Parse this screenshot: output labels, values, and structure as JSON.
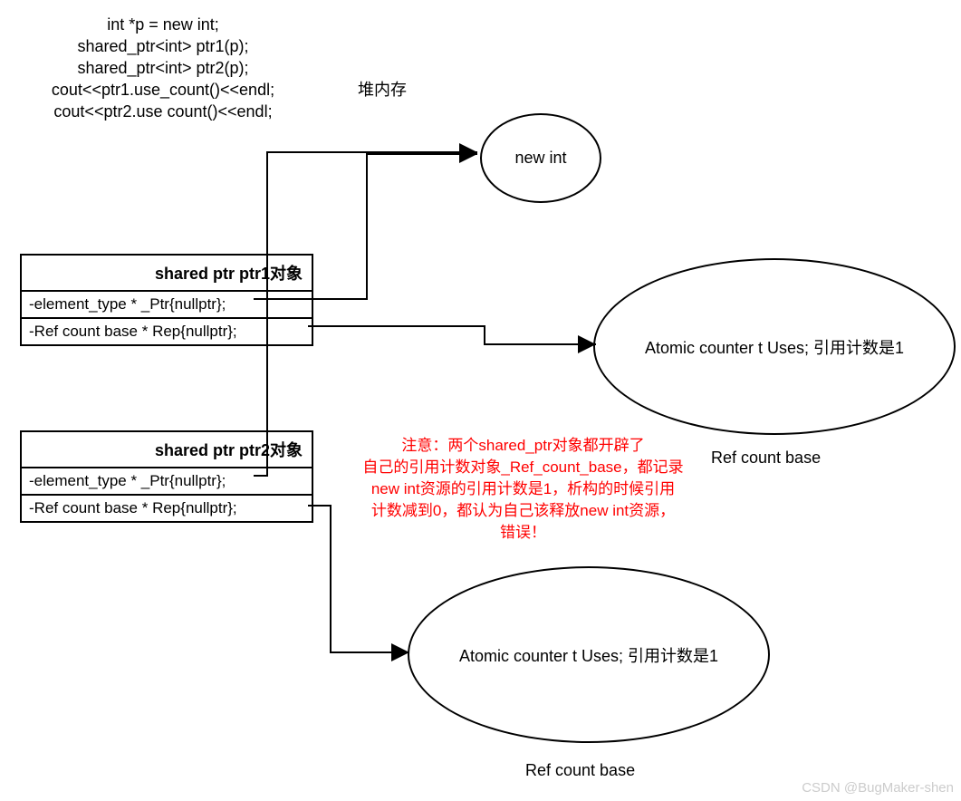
{
  "code": {
    "l1": "int *p = new int;",
    "l2": "shared_ptr<int> ptr1(p);",
    "l3": "shared_ptr<int> ptr2(p);",
    "l4": "cout<<ptr1.use_count()<<endl;",
    "l5": "cout<<ptr2.use count()<<endl;"
  },
  "labels": {
    "heap": "堆内存",
    "new_int": "new int",
    "atomic1": "Atomic counter t  Uses;   引用计数是1",
    "atomic2": "Atomic counter t  Uses;   引用计数是1",
    "refbase1": "Ref count base",
    "refbase2": "Ref count base"
  },
  "box1": {
    "title": "shared ptr ptr1对象",
    "r1": "-element_type * _Ptr{nullptr};",
    "r2": "-Ref count base *  Rep{nullptr};"
  },
  "box2": {
    "title": "shared ptr ptr2对象",
    "r1": "-element_type * _Ptr{nullptr};",
    "r2": "-Ref count base *  Rep{nullptr};"
  },
  "note": {
    "l1": "注意：两个shared_ptr对象都开辟了",
    "l2": "自己的引用计数对象_Ref_count_base，都记录",
    "l3": "new int资源的引用计数是1，析构的时候引用",
    "l4": "计数减到0，都认为自己该释放new int资源，",
    "l5": "错误！"
  },
  "watermark": "CSDN @BugMaker-shen"
}
